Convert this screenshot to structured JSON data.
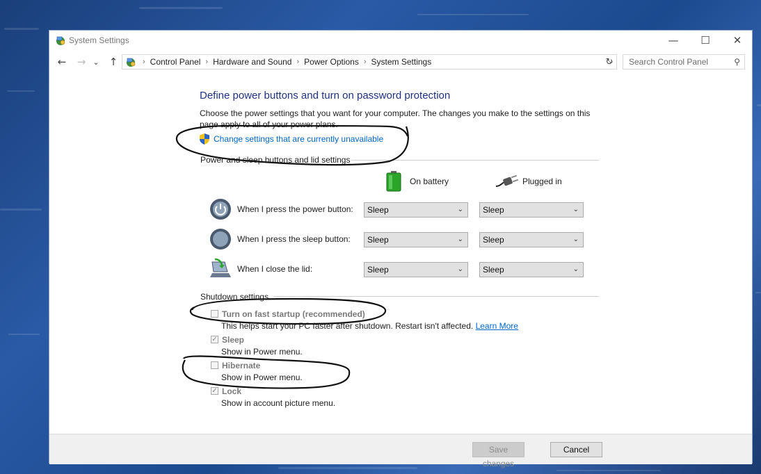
{
  "window": {
    "title": "System Settings",
    "minimize_glyph": "—",
    "maximize_glyph": "☐",
    "close_glyph": "✕"
  },
  "addressbar": {
    "back_glyph": "←",
    "forward_glyph": "→",
    "recent_glyph": "⌄",
    "up_glyph": "↑",
    "breadcrumbs": [
      "Control Panel",
      "Hardware and Sound",
      "Power Options",
      "System Settings"
    ],
    "separator": "›",
    "dropdown_glyph": "⌄",
    "refresh_glyph": "↻",
    "search_placeholder": "Search Control Panel",
    "search_glyph": "⚲"
  },
  "main": {
    "heading": "Define power buttons and turn on password protection",
    "description": "Choose the power settings that you want for your computer. The changes you make to the settings on this page apply to all of your power plans.",
    "change_link": "Change settings that are currently unavailable",
    "power_group_label": "Power and sleep buttons and lid settings",
    "col_battery": "On battery",
    "col_plugged": "Plugged in",
    "rows": [
      {
        "label": "When I press the power button:",
        "battery": "Sleep",
        "plugged": "Sleep"
      },
      {
        "label": "When I press the sleep button:",
        "battery": "Sleep",
        "plugged": "Sleep"
      },
      {
        "label": "When I close the lid:",
        "battery": "Sleep",
        "plugged": "Sleep"
      }
    ],
    "shutdown_group_label": "Shutdown settings",
    "options": [
      {
        "label": "Turn on fast startup (recommended)",
        "sub": "This helps start your PC faster after shutdown. Restart isn't affected.",
        "link": "Learn More",
        "checked": false
      },
      {
        "label": "Sleep",
        "sub": "Show in Power menu.",
        "checked": true
      },
      {
        "label": "Hibernate",
        "sub": "Show in Power menu.",
        "checked": false
      },
      {
        "label": "Lock",
        "sub": "Show in account picture menu.",
        "checked": true
      }
    ],
    "caret_glyph": "⌄"
  },
  "footer": {
    "save_label": "Save changes",
    "cancel_label": "Cancel"
  },
  "colors": {
    "link": "#0066cc",
    "heading": "#1e3287"
  }
}
